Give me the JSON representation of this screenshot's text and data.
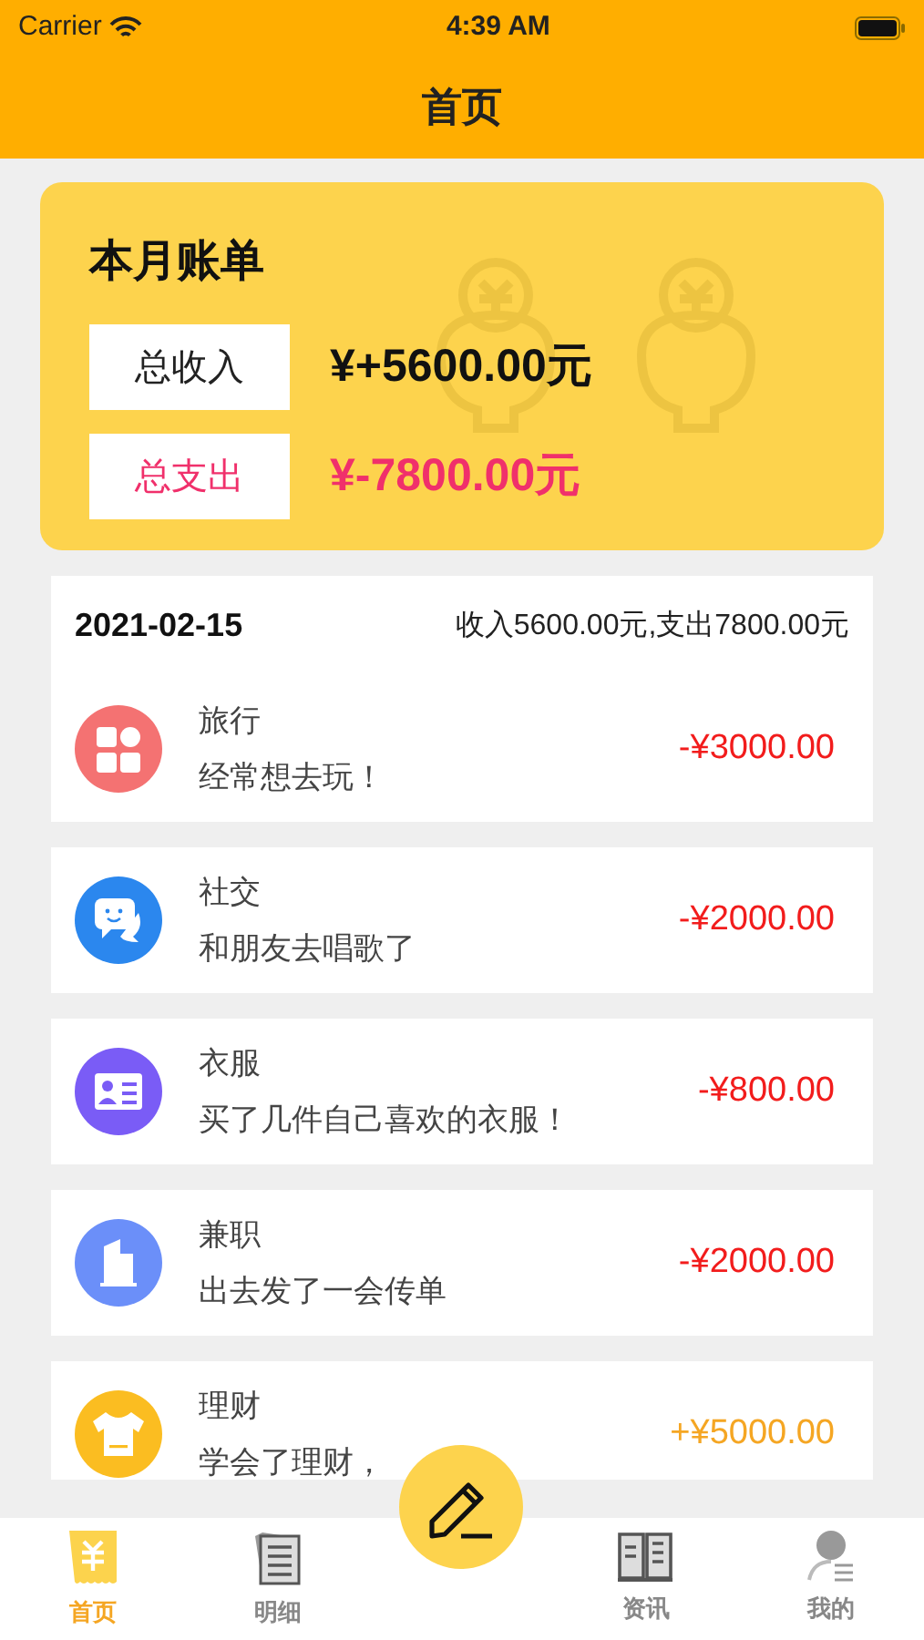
{
  "status_bar": {
    "carrier": "Carrier",
    "time": "4:39 AM"
  },
  "nav": {
    "title": "首页"
  },
  "summary": {
    "title": "本月账单",
    "income_label": "总收入",
    "income_value": "¥+5600.00元",
    "expense_label": "总支出",
    "expense_value": "¥-7800.00元"
  },
  "day": {
    "date": "2021-02-15",
    "totals": "收入5600.00元,支出7800.00元"
  },
  "entries": [
    {
      "color": "#f47272",
      "title": "旅行",
      "note": "经常想去玩！",
      "amount": "-¥3000.00",
      "kind": "expense"
    },
    {
      "color": "#2b87ee",
      "title": "社交",
      "note": "和朋友去唱歌了",
      "amount": "-¥2000.00",
      "kind": "expense"
    },
    {
      "color": "#7a5cf6",
      "title": "衣服",
      "note": "买了几件自己喜欢的衣服！",
      "amount": "-¥800.00",
      "kind": "expense"
    },
    {
      "color": "#6b8ff9",
      "title": "兼职",
      "note": "出去发了一会传单",
      "amount": "-¥2000.00",
      "kind": "expense"
    },
    {
      "color": "#fbbd21",
      "title": "理财",
      "note": "学会了理财，",
      "amount": "+¥5000.00",
      "kind": "income"
    }
  ],
  "tabs": [
    {
      "label": "首页",
      "selected": true
    },
    {
      "label": "明细",
      "selected": false
    },
    {
      "label": "资讯",
      "selected": false
    },
    {
      "label": "我的",
      "selected": false
    }
  ]
}
